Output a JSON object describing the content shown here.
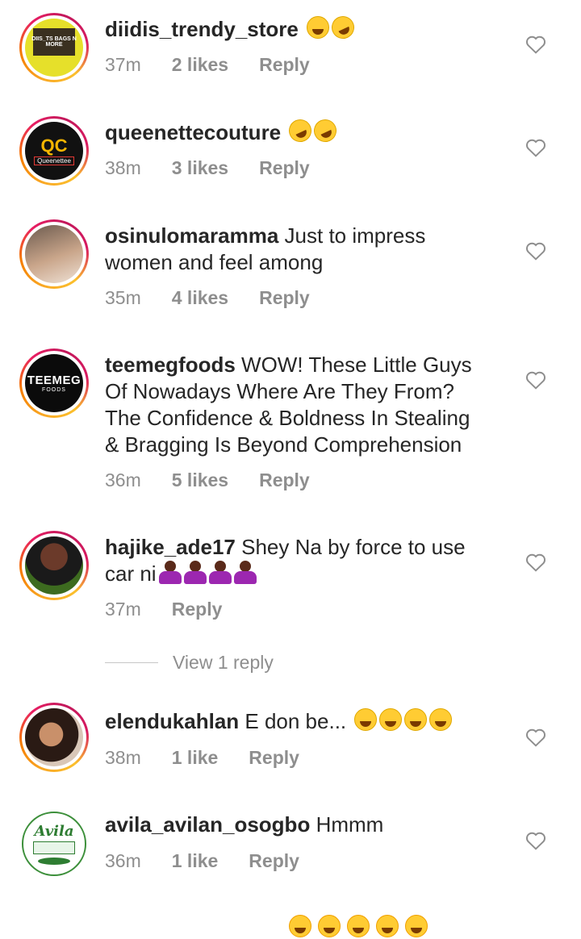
{
  "comments": [
    {
      "username": "diidis_trendy_store",
      "text": "",
      "time": "37m",
      "likes": "2 likes",
      "reply": "Reply",
      "avatar_text": "DIIS_TS BAGS N MORE"
    },
    {
      "username": "queenettecouture",
      "text": "",
      "time": "38m",
      "likes": "3 likes",
      "reply": "Reply",
      "avatar_text": "QC",
      "avatar_sub": "Queenettee"
    },
    {
      "username": "osinulomaramma",
      "text": "Just to impress",
      "text2": "women and feel among",
      "time": "35m",
      "likes": "4 likes",
      "reply": "Reply"
    },
    {
      "username": "teemegfoods",
      "text": "WOW! These Little Guys",
      "text2": "Of Nowadays Where Are They From?",
      "text3": "The Confidence & Boldness In Stealing",
      "text4": "& Bragging Is Beyond Comprehension",
      "time": "36m",
      "likes": "5 likes",
      "reply": "Reply",
      "avatar_text": "TEEMEG",
      "avatar_sub": "FOODS"
    },
    {
      "username": "hajike_ade17",
      "text": "Shey Na by force to use",
      "text2": "car ni",
      "time": "37m",
      "reply": "Reply"
    },
    {
      "username": "elendukahlan",
      "text": "E don be...",
      "time": "38m",
      "likes": "1 like",
      "reply": "Reply"
    },
    {
      "username": "avila_avilan_osogbo",
      "text": "Hmmm",
      "time": "36m",
      "likes": "1 like",
      "reply": "Reply",
      "avatar_text": "Avila"
    }
  ],
  "view_replies": "View 1 reply",
  "icons": {
    "like": "heart-outline-icon",
    "laugh": "tears-of-joy-emoji",
    "rofl": "rolling-laughing-emoji",
    "shrug": "woman-shrugging-emoji"
  }
}
